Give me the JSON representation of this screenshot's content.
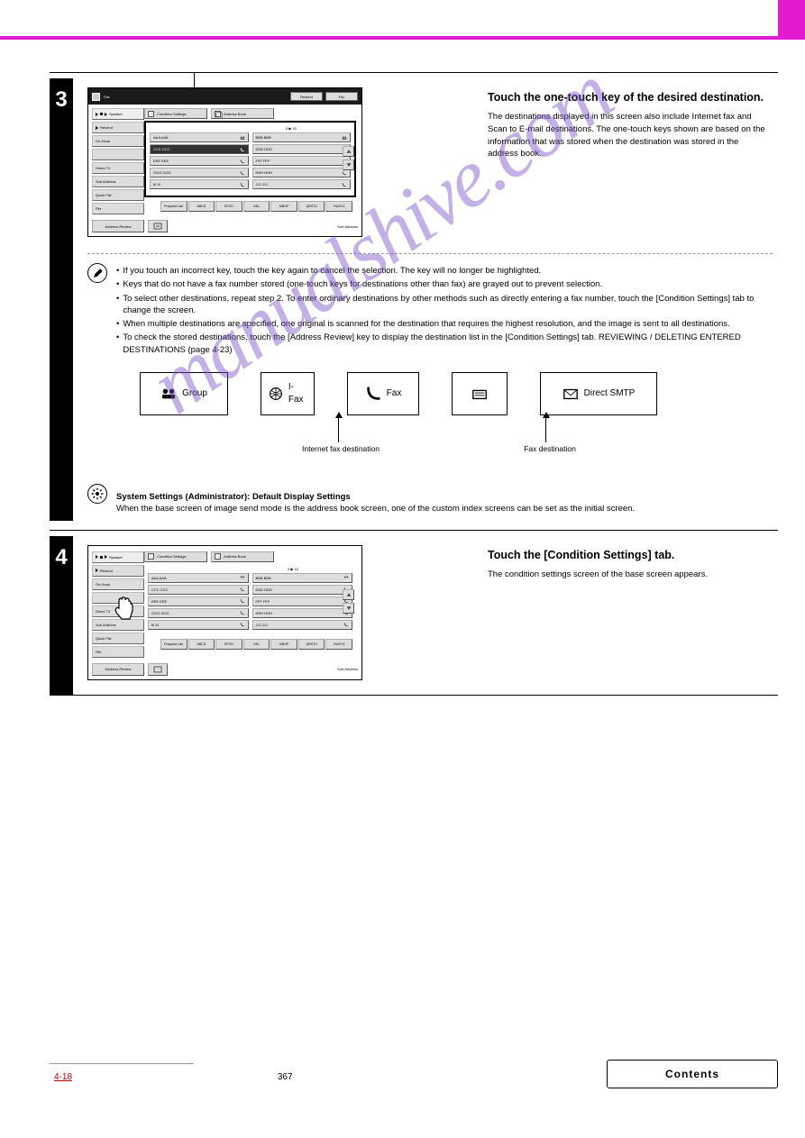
{
  "watermark": "manualshive.com",
  "footer": {
    "chapter": "4-18",
    "page": "367",
    "contents": "Contents"
  },
  "section3": {
    "num": "3",
    "title": "Touch the one-touch key of the desired destination.",
    "right_html": "The destinations displayed in this screen also include Internet fax and Scan to E-mail destinations. The one-touch keys shown are based on the information that was stored when the destination was stored in the address book.",
    "arrowTop": 0,
    "panel": {
      "doctitle": "Fax",
      "header": {
        "right1": "Resend",
        "right2": "Fax"
      },
      "sidebar": [
        "Speaker",
        "Resend",
        "On-Hook",
        "",
        "Direct TX",
        "Sub Address",
        "Quick File",
        "File"
      ],
      "tabs": [
        "Condition Settings",
        "Address Book"
      ],
      "addresses": [
        [
          "AAA AAA",
          "BBB BBB"
        ],
        [
          "CCC CCC",
          "DDD DDD"
        ],
        [
          "EEE EEE",
          "FFF FFF"
        ],
        [
          "GGG GGG",
          "HHH HHH"
        ],
        [
          "III III",
          "JJJ JJJ"
        ]
      ],
      "range": "5 ▶ 10",
      "letters": [
        "Frequent Use",
        "ABCD",
        "EFGH",
        "IJKL",
        "MNOP",
        "QRSTU",
        "VWXYZ"
      ],
      "footer": {
        "review": "Address Review",
        "sort": "Sort Address"
      }
    },
    "notes": [
      "If you touch an incorrect key, touch the key again to cancel the selection. The key will no longer be highlighted.",
      "Keys that do not have a fax number stored (one-touch keys for destinations other than fax) are grayed out to prevent selection.",
      "To select other destinations, repeat step 2. To enter ordinary destinations by other methods such as directly entering a fax number, touch the [Condition Settings] tab to change the screen.",
      "When multiple destinations are specified, one original is scanned for the destination that requires the highest resolution, and the image is sent to all destinations.",
      "To check the stored destinations, touch the [Address Review] key to display the destination list in the [Condition Settings] tab. REVIEWING / DELETING ENTERED DESTINATIONS (page 4-23)"
    ],
    "iconLabels": {
      "group": "Group",
      "ifax": "I-Fax",
      "fax": "Fax",
      "directsmtp": "Direct SMTP"
    },
    "labels": {
      "ifax_desc": "Internet fax destination",
      "fax_desc": "Fax destination"
    },
    "system": {
      "title": "System Settings (Administrator): Default Display Settings",
      "desc": "When the base screen of image send mode is the address book screen, one of the custom index screens can be set as the initial screen."
    }
  },
  "section4": {
    "num": "4",
    "title": "Touch the [Condition Settings] tab.",
    "right": "The condition settings screen of the base screen appears.",
    "panel": {
      "sidebar": [
        "Speaker",
        "Resend",
        "On-Hook",
        "",
        "Direct TX",
        "Sub Address",
        "Quick File",
        "File"
      ],
      "tabs": [
        "Condition Settings",
        "Address Book"
      ],
      "addresses": [
        [
          "AAA AAA",
          "BBB BBB"
        ],
        [
          "CCC CCC",
          "DDD DDD"
        ],
        [
          "EEE EEE",
          "FFF FFF"
        ],
        [
          "GGG GGG",
          "HHH HHH"
        ],
        [
          "III III",
          "JJJ JJJ"
        ]
      ],
      "range": "5 ▶ 10",
      "letters": [
        "Frequent Use",
        "ABCD",
        "EFGH",
        "IJKL",
        "MNOP",
        "QRSTU",
        "VWXYZ"
      ],
      "footer": {
        "review": "Address Review",
        "sort": "Sort Address"
      }
    }
  }
}
